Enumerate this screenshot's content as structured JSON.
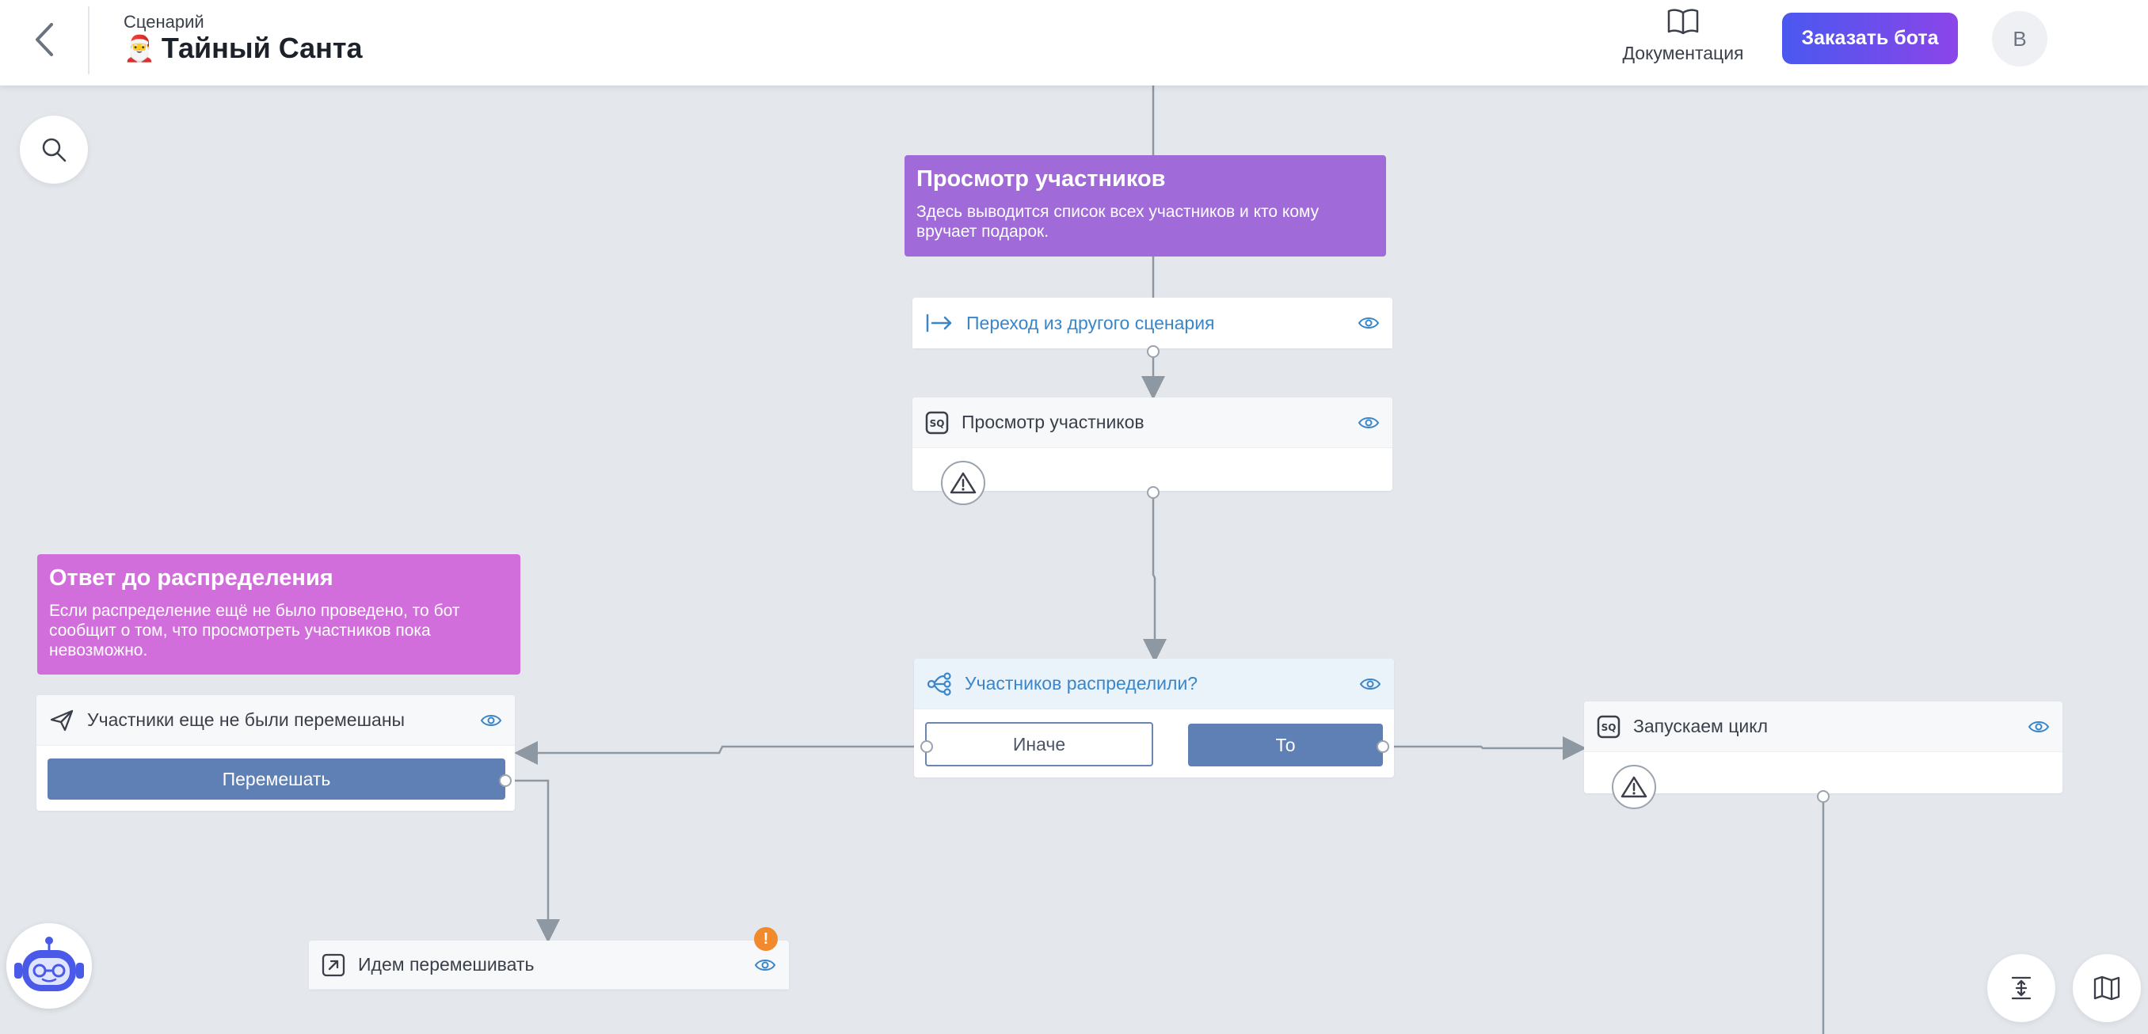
{
  "header": {
    "scenario_caption": "Сценарий",
    "scenario_emoji": "🎅",
    "scenario_title": "Тайный Санта",
    "docs_label": "Документация",
    "order_button": "Заказать бота",
    "avatar_letter": "B"
  },
  "notes": {
    "view_participants": {
      "title": "Просмотр участников",
      "text": "Здесь выводится список всех участников и кто кому вручает подарок."
    },
    "answer_before": {
      "title": "Ответ до распределения",
      "text": "Если распределение ещё не было проведено, то бот сообщит о том, что просмотреть участников пока невозможно."
    }
  },
  "nodes": {
    "transition": {
      "label": "Переход из другого сценария"
    },
    "view_participants": {
      "label": "Просмотр участников"
    },
    "condition": {
      "label": "Участников распределили?",
      "else_label": "Иначе",
      "then_label": "То"
    },
    "not_shuffled": {
      "label": "Участники еще не были перемешаны",
      "button_label": "Перемешать"
    },
    "go_shuffle": {
      "label": "Идем перемешивать",
      "alert": "!"
    },
    "start_cycle": {
      "label": "Запускаем цикл"
    }
  },
  "colors": {
    "accent_blue": "#3a86c8",
    "note_purple": "#a06ad8",
    "note_magenta": "#d26edb",
    "button_filled": "#5f80b4",
    "alert_orange": "#f08a2c",
    "canvas_bg": "#e4e8ed"
  },
  "icons": {
    "back": "chevron-left-icon",
    "docs": "book-icon",
    "search": "search-icon",
    "transition": "arrow-from-bar-icon",
    "sql": "sql-icon",
    "condition": "branch-icon",
    "message": "send-icon",
    "goto": "arrow-up-right-box-icon",
    "eye": "eye-icon",
    "warning": "warning-triangle-icon",
    "bot": "bot-icon",
    "align": "align-center-icon",
    "map": "map-icon"
  }
}
